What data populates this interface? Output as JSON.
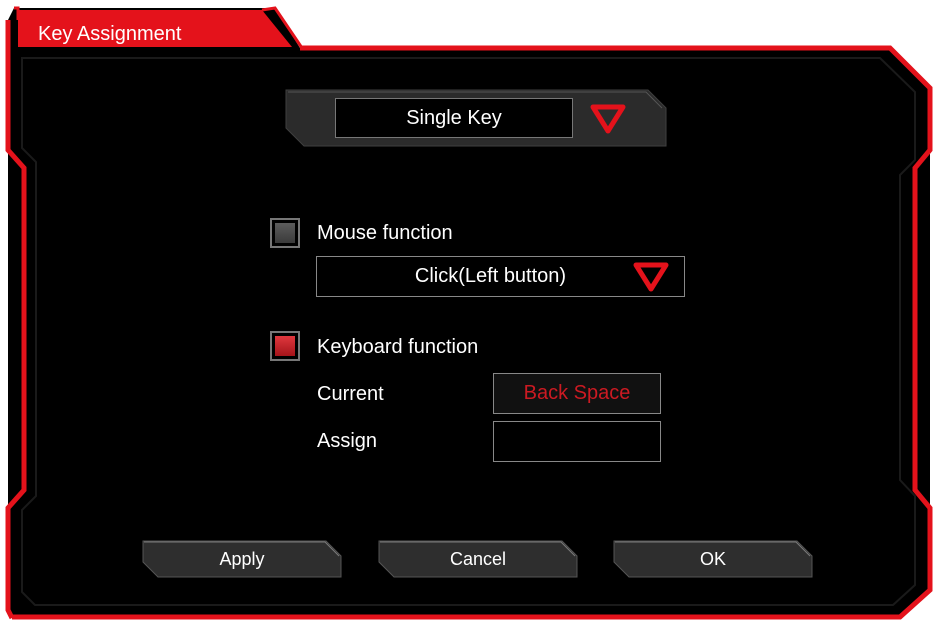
{
  "window": {
    "title": "Key Assignment"
  },
  "mode_selector": {
    "value": "Single Key",
    "arrow_icon": "triangle-down-icon"
  },
  "mouse_function": {
    "label": "Mouse function",
    "checked": false,
    "dropdown_value": "Click(Left button)",
    "arrow_icon": "triangle-down-icon"
  },
  "keyboard_function": {
    "label": "Keyboard function",
    "checked": true,
    "current_label": "Current",
    "current_value": "Back Space",
    "assign_label": "Assign",
    "assign_value": ""
  },
  "buttons": {
    "apply": "Apply",
    "cancel": "Cancel",
    "ok": "OK"
  },
  "colors": {
    "accent": "#e4121b",
    "background": "#000000",
    "text": "#ffffff",
    "current_value": "#cc1a22"
  }
}
